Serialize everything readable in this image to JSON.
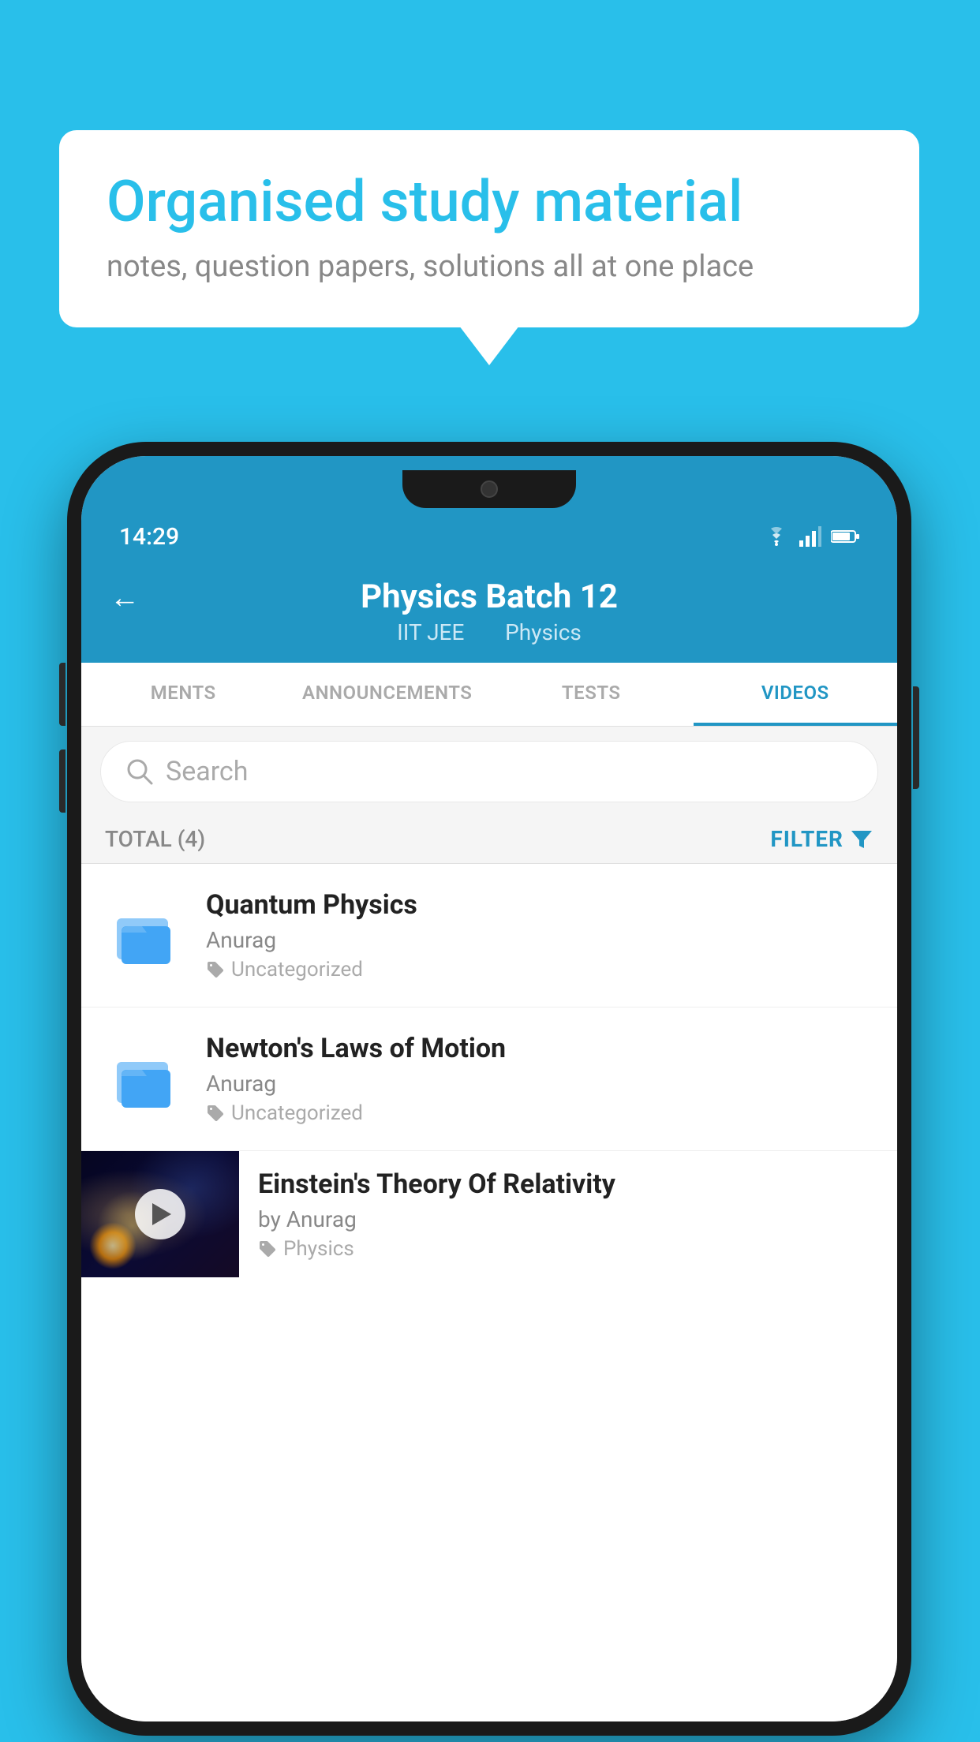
{
  "bubble": {
    "heading": "Organised study material",
    "subtext": "notes, question papers, solutions all at one place"
  },
  "statusBar": {
    "time": "14:29",
    "icons": [
      "wifi",
      "signal",
      "battery"
    ]
  },
  "header": {
    "title": "Physics Batch 12",
    "subtitle1": "IIT JEE",
    "subtitle2": "Physics",
    "backLabel": "←"
  },
  "tabs": [
    {
      "label": "MENTS",
      "active": false
    },
    {
      "label": "ANNOUNCEMENTS",
      "active": false
    },
    {
      "label": "TESTS",
      "active": false
    },
    {
      "label": "VIDEOS",
      "active": true
    }
  ],
  "search": {
    "placeholder": "Search"
  },
  "filterBar": {
    "totalLabel": "TOTAL (4)",
    "filterLabel": "FILTER"
  },
  "videos": [
    {
      "id": 1,
      "title": "Quantum Physics",
      "author": "Anurag",
      "tag": "Uncategorized",
      "type": "folder"
    },
    {
      "id": 2,
      "title": "Newton's Laws of Motion",
      "author": "Anurag",
      "tag": "Uncategorized",
      "type": "folder"
    },
    {
      "id": 3,
      "title": "Einstein's Theory Of Relativity",
      "author": "by Anurag",
      "tag": "Physics",
      "type": "video"
    }
  ]
}
